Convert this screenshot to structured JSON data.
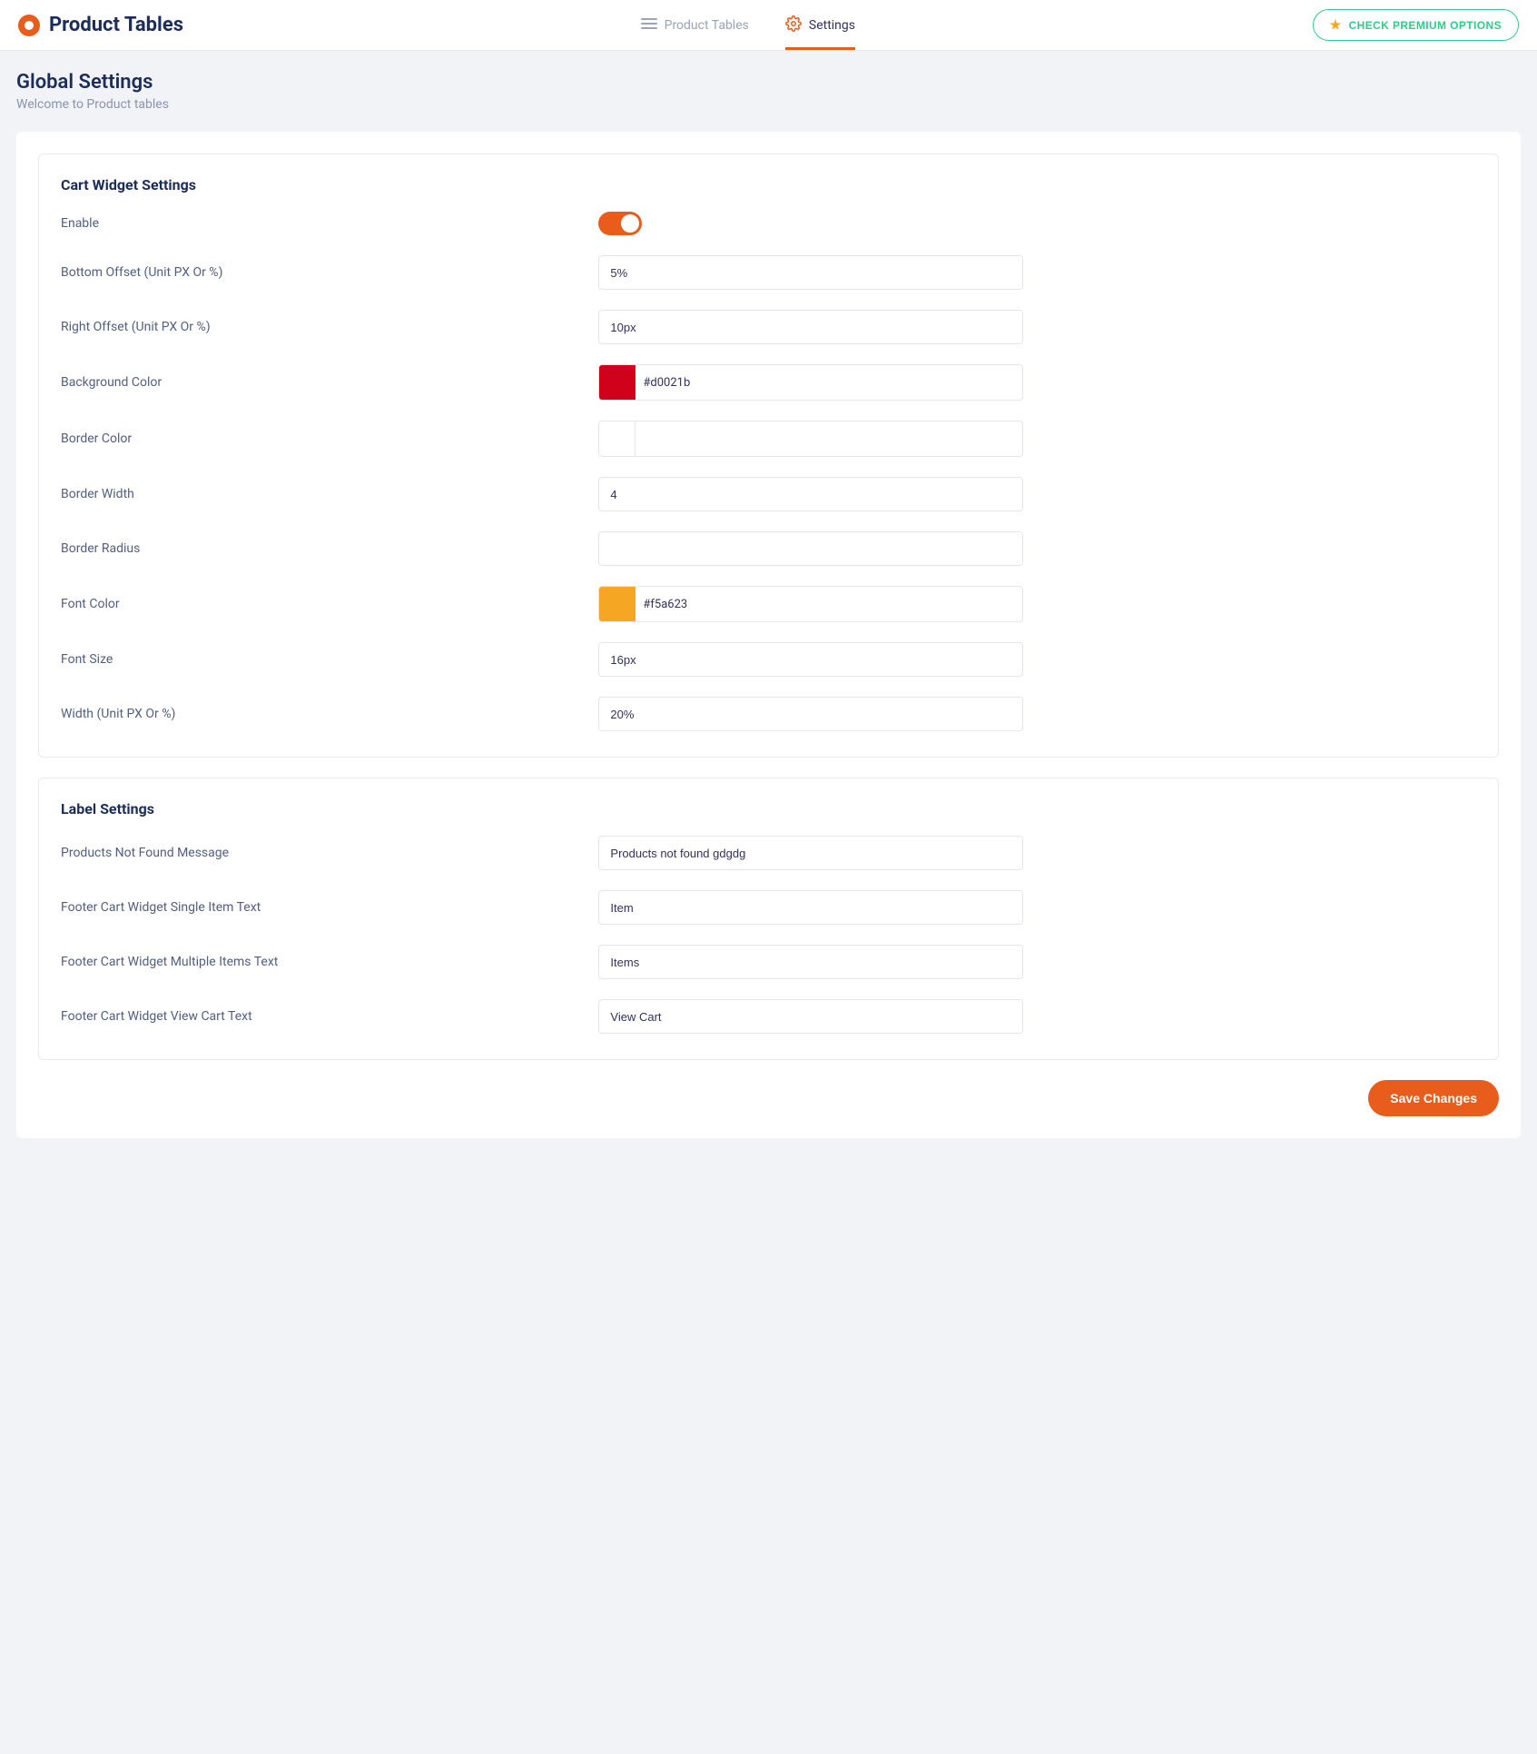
{
  "header": {
    "brand_title": "Product Tables",
    "tabs": [
      {
        "label": "Product Tables",
        "active": false
      },
      {
        "label": "Settings",
        "active": true
      }
    ],
    "premium_label": "CHECK PREMIUM OPTIONS"
  },
  "page": {
    "title": "Global Settings",
    "subtitle": "Welcome to Product tables"
  },
  "cart_widget": {
    "panel_title": "Cart Widget Settings",
    "enable_label": "Enable",
    "enable_value": true,
    "bottom_offset_label": "Bottom Offset (Unit PX Or %)",
    "bottom_offset_value": "5%",
    "right_offset_label": "Right Offset (Unit PX Or %)",
    "right_offset_value": "10px",
    "background_color_label": "Background Color",
    "background_color_value": "#d0021b",
    "border_color_label": "Border Color",
    "border_color_value": "",
    "border_color_swatch": "#ffffff",
    "border_width_label": "Border Width",
    "border_width_value": "4",
    "border_radius_label": "Border Radius",
    "border_radius_value": "",
    "font_color_label": "Font Color",
    "font_color_value": "#f5a623",
    "font_size_label": "Font Size",
    "font_size_value": "16px",
    "width_label": "Width (Unit PX Or %)",
    "width_value": "20%"
  },
  "label_settings": {
    "panel_title": "Label Settings",
    "not_found_label": "Products Not Found Message",
    "not_found_value": "Products not found gdgdg",
    "single_item_label": "Footer Cart Widget Single Item Text",
    "single_item_value": "Item",
    "multi_item_label": "Footer Cart Widget Multiple Items Text",
    "multi_item_value": "Items",
    "view_cart_label": "Footer Cart Widget View Cart Text",
    "view_cart_value": "View Cart"
  },
  "actions": {
    "save_label": "Save Changes"
  }
}
